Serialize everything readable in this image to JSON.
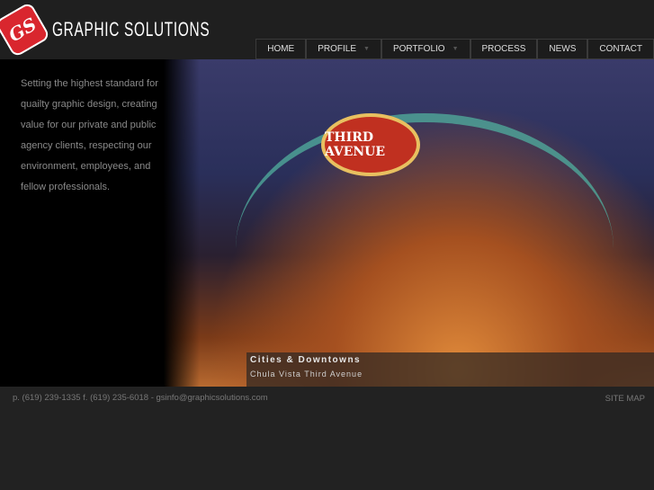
{
  "brand": {
    "name": "GRAPHIC SOLUTIONS",
    "mark": "GS",
    "accent": "#d9262e"
  },
  "nav": [
    {
      "label": "HOME"
    },
    {
      "label": "PROFILE",
      "dropdown": true
    },
    {
      "label": "PORTFOLIO",
      "dropdown": true
    },
    {
      "label": "PROCESS"
    },
    {
      "label": "NEWS"
    },
    {
      "label": "CONTACT"
    }
  ],
  "tagline": "Setting the highest standard for quailty graphic design, creating value for our private and public agency clients, respecting our environment, employees, and fellow professionals.",
  "feature": {
    "sign": "THIRD AVENUE",
    "title": "Cities & Downtowns",
    "subtitle": "Chula Vista Third Avenue"
  },
  "footer": {
    "contact": "p. (619) 239-1335 f. (619) 235-6018 - gsinfo@graphicsolutions.com",
    "sitemap": "SITE MAP"
  }
}
